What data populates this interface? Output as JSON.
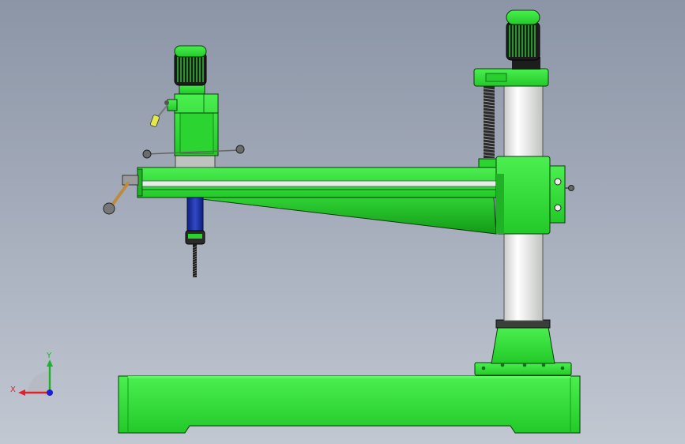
{
  "viewport": {
    "background_top": "#8c95a6",
    "background_bottom": "#c2c8d2"
  },
  "model": {
    "body_color": "#35e53a",
    "dark_green": "#1f9e25",
    "column_color": "#f4f6f4",
    "motor_fin_color": "#1b1b1b",
    "spindle_color": "#1b2f9c",
    "outline_color": "#0c3a0e"
  },
  "triad": {
    "x_label": "X",
    "y_label": "Y",
    "x_color": "#e3202a",
    "y_color": "#19b42a",
    "z_color": "#1d1fd1"
  }
}
